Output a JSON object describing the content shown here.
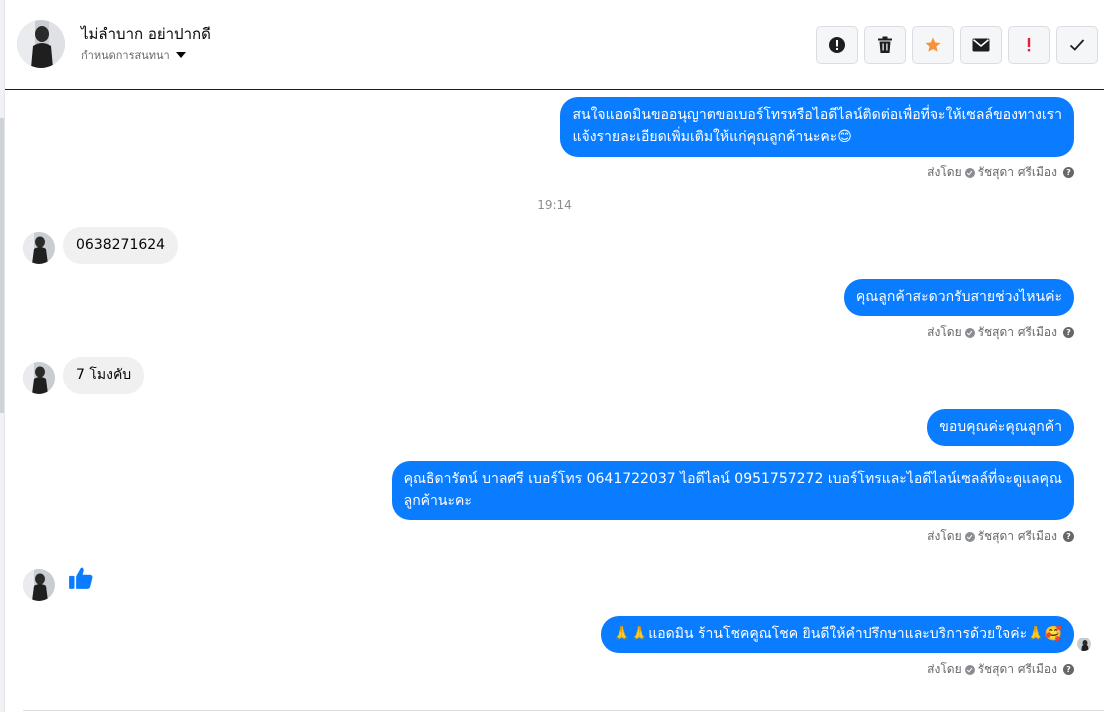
{
  "header": {
    "contact_name": "ไม่ลำบาก อย่าปากดี",
    "subtitle": "กำหนดการสนทนา",
    "avatar_icon": "profile-photo",
    "toolbar": [
      {
        "name": "spam-icon",
        "color": "#1c1e21"
      },
      {
        "name": "trash-icon",
        "color": "#1c1e21"
      },
      {
        "name": "star-icon",
        "color": "#f7923a"
      },
      {
        "name": "envelope-icon",
        "color": "#1c1e21"
      },
      {
        "name": "important-icon",
        "color": "#e41e3f"
      },
      {
        "name": "checkmark-icon",
        "color": "#1c1e21"
      }
    ]
  },
  "colors": {
    "outgoing_bubble": "#0a7cff",
    "incoming_bubble": "#f0f0f0",
    "meta_text": "#65676b"
  },
  "messages": {
    "m1": {
      "line1": "สนใจแอดมินขออนุญาตขอเบอร์โทรหรือไอดีไลน์ติดต่อเพื่อที่จะให้เซลล์ของทางเรา",
      "line2": "แจ้งรายละเอียดเพิ่มเติมให้แก่คุณลูกค้านะคะ😊"
    },
    "time_divider": "19:14",
    "m2": "0638271624",
    "m3": "คุณลูกค้าสะดวกรับสายช่วงไหนค่ะ",
    "m4": "7 โมงคับ",
    "m5": "ขอบคุณค่ะคุณลูกค้า",
    "m6": {
      "line1": "คุณธิดารัตน์ บาลศรี เบอร์โทร 0641722037  ไอดีไลน์ 0951757272   เบอร์โทรและไอดีไลน์เซลล์ที่จะดูแลคุณ",
      "line2": "ลูกค้านะคะ"
    },
    "m7_icon": "thumbs-up-icon",
    "m8": "🙏🙏แอดมิน ร้านโชคคูณโชค ยินดีให้คำปรึกษาและบริการด้วยใจค่ะ🙏🥰"
  },
  "sent_by": {
    "label": "ส่งโดย",
    "agent": "รัชสุดา ศรีเมือง"
  }
}
